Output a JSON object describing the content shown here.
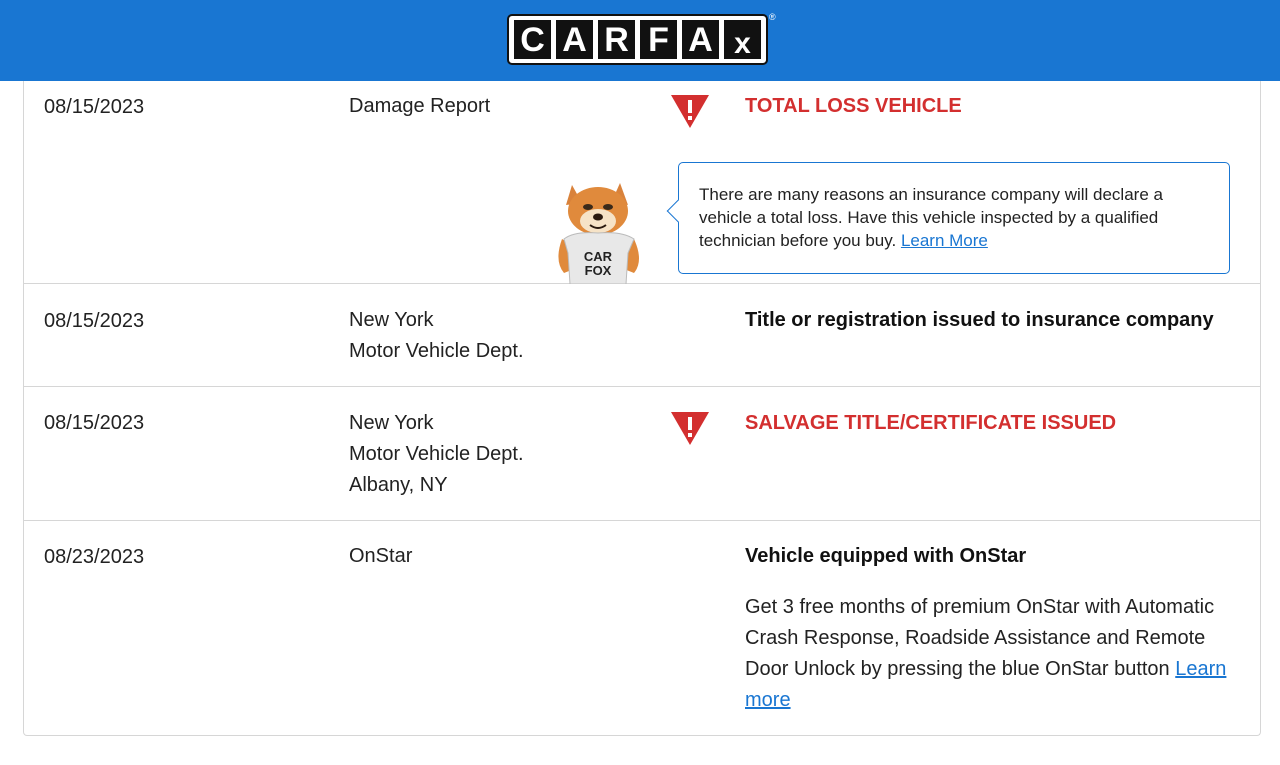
{
  "header": {
    "logo_letters": [
      "C",
      "A",
      "R",
      "F",
      "A",
      "x"
    ],
    "registered_mark": "®",
    "bg_color": "#1976d2"
  },
  "rows": [
    {
      "date": "08/15/2023",
      "source_lines": [
        "Damage Report"
      ],
      "alert": true,
      "title": "TOTAL LOSS VEHICLE",
      "tooltip": {
        "text": "There are many reasons an insurance company will declare a vehicle a total loss. Have this vehicle inspected by a qualified technician before you buy.",
        "link": "Learn More"
      },
      "mascot_shirt": [
        "CAR",
        "FOX"
      ]
    },
    {
      "date": "08/15/2023",
      "source_lines": [
        "New York",
        "Motor Vehicle Dept."
      ],
      "alert": false,
      "title": "Title or registration issued to insurance company"
    },
    {
      "date": "08/15/2023",
      "source_lines": [
        "New York",
        "Motor Vehicle Dept.",
        "Albany, NY"
      ],
      "alert": true,
      "title": "SALVAGE TITLE/CERTIFICATE ISSUED"
    },
    {
      "date": "08/23/2023",
      "source_lines": [
        "OnStar"
      ],
      "alert": false,
      "title": "Vehicle equipped with OnStar",
      "description": "Get 3 free months of premium OnStar with Automatic Crash Response, Roadside Assistance and Remote Door Unlock by pressing the blue OnStar button",
      "link": "Learn more"
    }
  ],
  "colors": {
    "alert": "#d32f2f",
    "link": "#1976d2",
    "border": "#d6d6d6"
  },
  "icons": {
    "alert_icon": "warning-triangle-icon"
  }
}
